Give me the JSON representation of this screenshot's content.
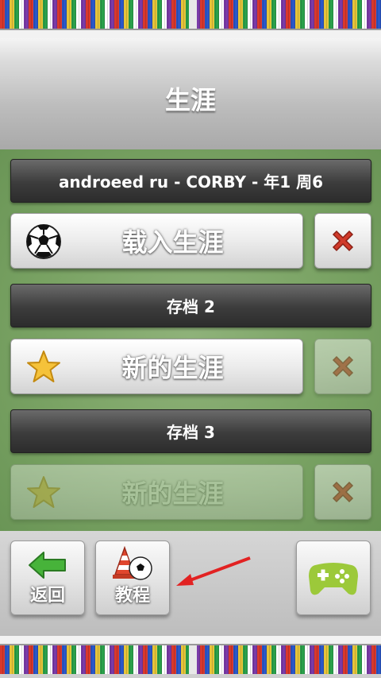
{
  "screen": {
    "title": "生涯"
  },
  "slots": [
    {
      "header": "androeed ru - CORBY - 年1 周6",
      "button_label": "载入生涯",
      "button_icon": "soccer-ball-icon",
      "enabled": true,
      "delete_enabled": true
    },
    {
      "header": "存档 2",
      "button_label": "新的生涯",
      "button_icon": "star-icon",
      "enabled": true,
      "delete_enabled": false
    },
    {
      "header": "存档 3",
      "button_label": "新的生涯",
      "button_icon": "star-icon",
      "enabled": false,
      "delete_enabled": false
    }
  ],
  "toolbar": {
    "back_label": "返回",
    "tutorial_label": "教程",
    "games_icon": "gamepad-icon"
  },
  "colors": {
    "pitch": "#7aa364",
    "header_bar": "#3c3c3c",
    "delete_red": "#d03a2a",
    "back_arrow_green": "#47b33a",
    "gamepad_green": "#9cc93a"
  }
}
